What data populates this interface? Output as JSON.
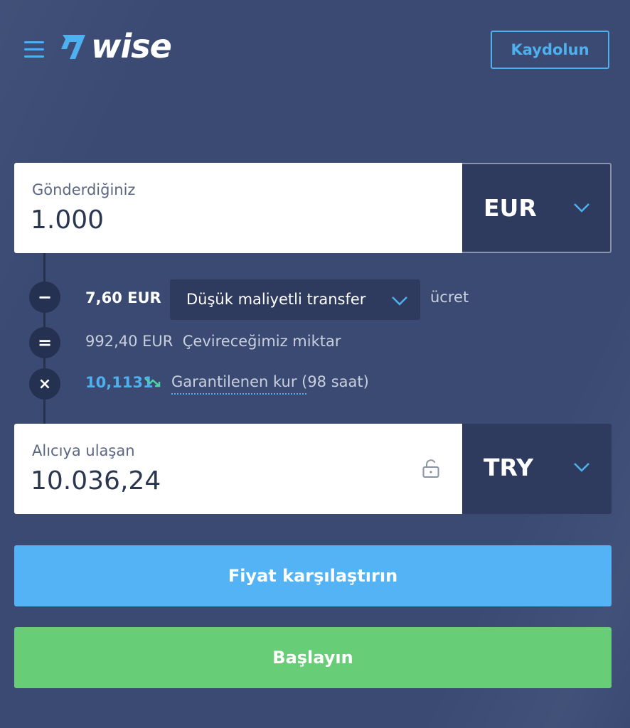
{
  "header": {
    "logo_text": "wise",
    "signup_label": "Kaydolun"
  },
  "send": {
    "label": "Gönderdiğiniz",
    "amount": "1.000",
    "currency": "EUR"
  },
  "breakdown": {
    "fee_symbol": "−",
    "fee_amount": "7,60 EUR",
    "fee_option": "Düşük maliyetli transfer",
    "fee_suffix": "ücret",
    "convert_symbol": "=",
    "convert_amount": "992,40 EUR",
    "convert_label": "Çevireceğimiz miktar",
    "rate_symbol": "×",
    "rate_value": "10,1131",
    "rate_label": "Garantilenen kur (98 saat)"
  },
  "receive": {
    "label": "Alıcıya ulaşan",
    "amount": "10.036,24",
    "currency": "TRY"
  },
  "actions": {
    "compare_label": "Fiyat karşılaştırın",
    "start_label": "Başlayın"
  },
  "icons": {
    "menu": "hamburger-menu-icon",
    "logo": "wise-flag-icon",
    "chevron": "chevron-down-icon",
    "lock": "unlock-icon",
    "trend": "trend-down-icon"
  },
  "colors": {
    "background": "#3a4a73",
    "accent_blue": "#53b3f5",
    "accent_green": "#67cd77",
    "dark_panel": "#2e3b5e"
  }
}
